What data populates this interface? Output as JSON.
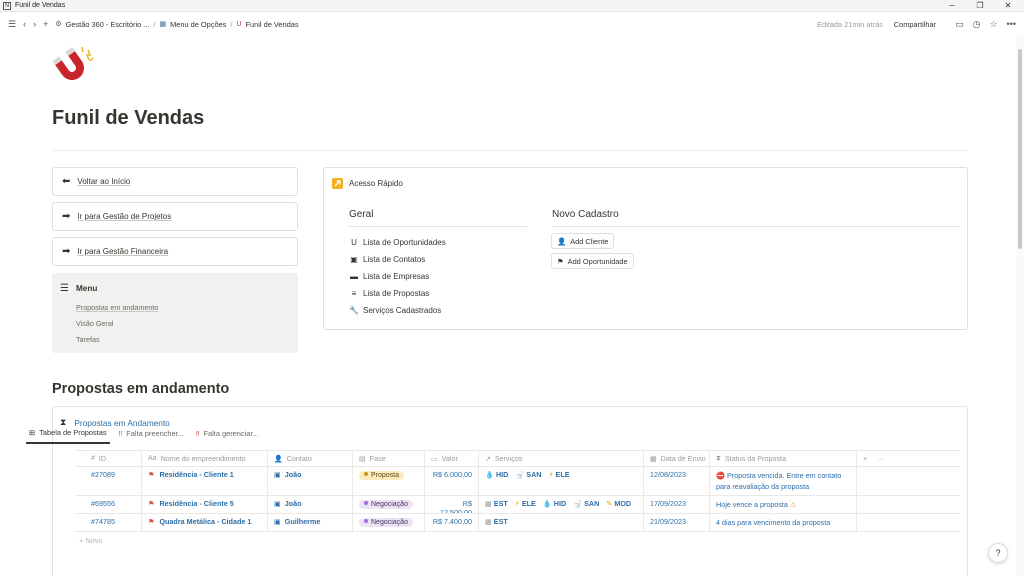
{
  "window": {
    "title": "Funil de Vendas"
  },
  "topbar": {
    "breadcrumbs": [
      {
        "label": "Gestão 360 - Escritório ..."
      },
      {
        "label": "Menu de Opções"
      },
      {
        "label": "Funil de Vendas"
      }
    ],
    "edited": "Editada 21min atrás",
    "share": "Compartilhar"
  },
  "page": {
    "title": "Funil de Vendas",
    "nav_buttons": [
      {
        "label": "Voltar ao Início"
      },
      {
        "label": "Ir para Gestão de Projetos"
      },
      {
        "label": "Ir para Gestão Financeira"
      }
    ],
    "menu": {
      "title": "Menu",
      "items": [
        "Propostas em andamento",
        "Visão Geral",
        "Tarefas"
      ]
    },
    "quick_access": {
      "title": "Acesso Rápido",
      "geral": {
        "title": "Geral",
        "items": [
          "Lista de Oportunidades",
          "Lista de Contatos",
          "Lista de Empresas",
          "Lista de Propostas",
          "Serviços Cadastrados"
        ]
      },
      "novo": {
        "title": "Novo Cadastro",
        "add_cliente": "Add Cliente",
        "add_oportunidade": "Add Oportunidade"
      }
    },
    "section_title": "Propostas em andamento"
  },
  "database": {
    "title": "Propostas em Andamento",
    "tabs": [
      "Tabela de Propostas",
      "Falta preencher...",
      "Falta gerenciar..."
    ],
    "columns": [
      "ID",
      "Nome do empreendimento",
      "Contato",
      "Fase",
      "Valor",
      "Serviços",
      "Data de Envio",
      "Status da Proposta"
    ],
    "rows": [
      {
        "id": "#27089",
        "name": "Residência - Cliente 1",
        "contact": "João",
        "phase": "Proposta",
        "value": "R$ 6.000,00",
        "services": [
          "HID",
          "SAN",
          "ELE"
        ],
        "date": "12/08/2023",
        "status": "Proposta vencida. Entre em contato para reavaliação da proposta"
      },
      {
        "id": "#69556",
        "name": "Residência - Cliente 5",
        "contact": "João",
        "phase": "Negociação",
        "value": "R$ 12.500,00",
        "services": [
          "EST",
          "ELE",
          "HID",
          "SAN",
          "MOD"
        ],
        "date": "17/09/2023",
        "status": "Hoje vence a proposta"
      },
      {
        "id": "#74785",
        "name": "Quadra Metálica - Cidade 1",
        "contact": "Guilherme",
        "phase": "Negociação",
        "value": "R$ 7.400,00",
        "services": [
          "EST"
        ],
        "date": "21/09/2023",
        "status": "4 dias para vencimento da proposta"
      }
    ],
    "new_label": "+ Novo"
  },
  "help": "?"
}
